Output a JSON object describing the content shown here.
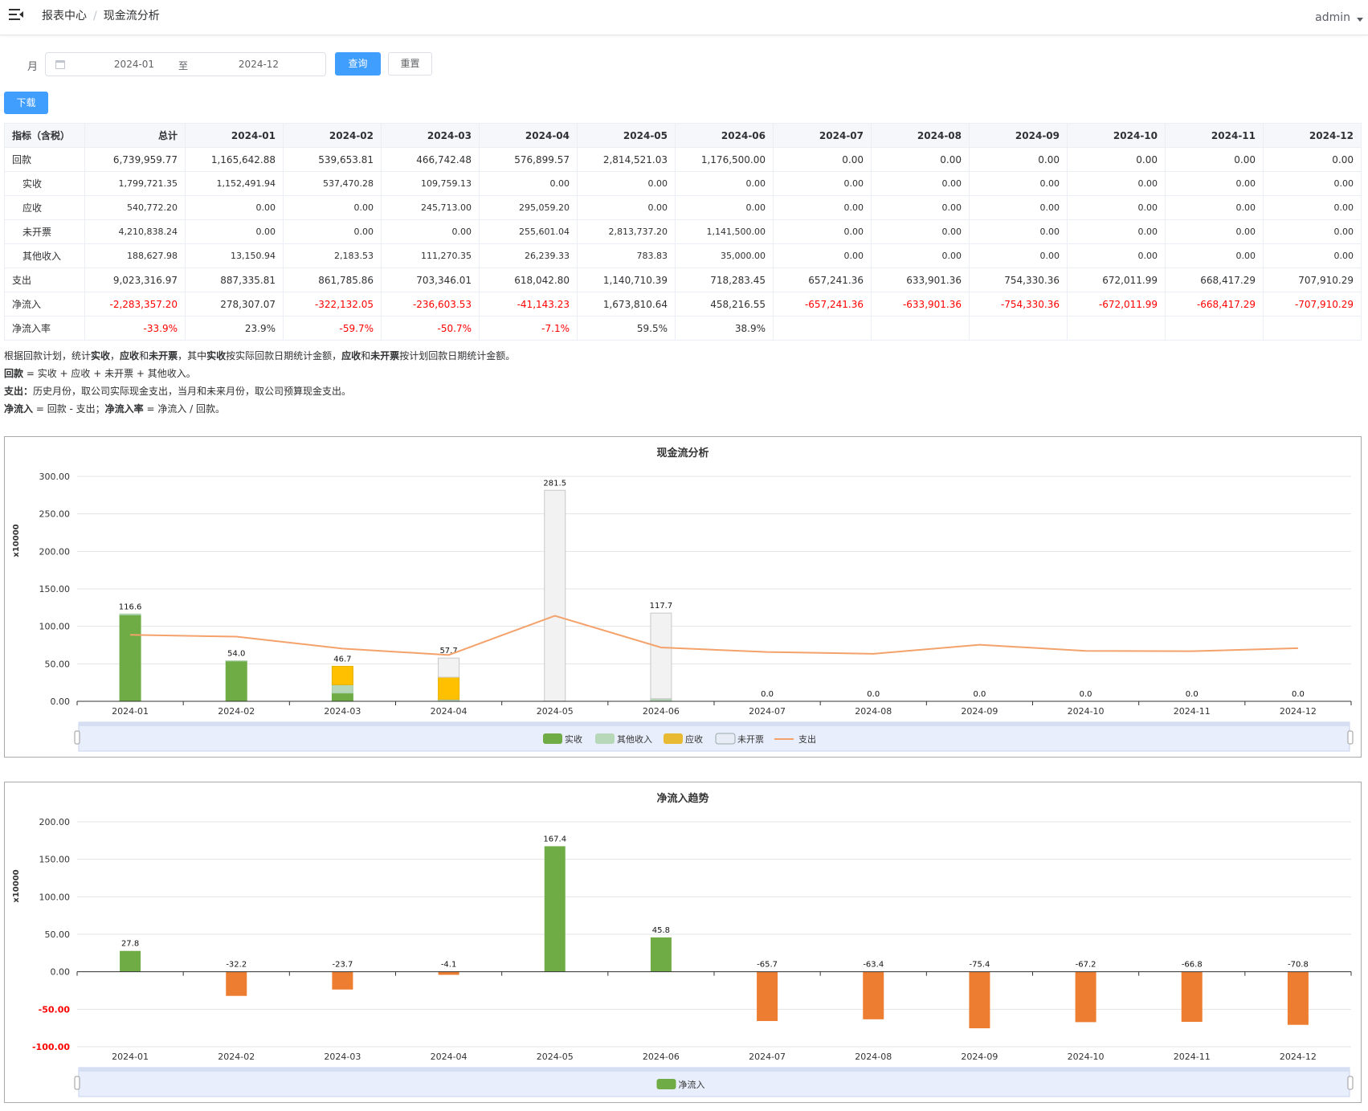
{
  "header": {
    "breadcrumb": [
      "报表中心",
      "现金流分析"
    ],
    "user": "admin"
  },
  "filter": {
    "label": "月",
    "start": "2024-01",
    "separator": "至",
    "end": "2024-12",
    "query_label": "查询",
    "reset_label": "重置"
  },
  "download_label": "下载",
  "table": {
    "headers": [
      "指标（含税）",
      "总计",
      "2024-01",
      "2024-02",
      "2024-03",
      "2024-04",
      "2024-05",
      "2024-06",
      "2024-07",
      "2024-08",
      "2024-09",
      "2024-10",
      "2024-11",
      "2024-12"
    ],
    "rows": [
      {
        "label": "回款",
        "sub": false,
        "cells": [
          "6,739,959.77",
          "1,165,642.88",
          "539,653.81",
          "466,742.48",
          "576,899.57",
          "2,814,521.03",
          "1,176,500.00",
          "0.00",
          "0.00",
          "0.00",
          "0.00",
          "0.00",
          "0.00"
        ]
      },
      {
        "label": "实收",
        "sub": true,
        "cells": [
          "1,799,721.35",
          "1,152,491.94",
          "537,470.28",
          "109,759.13",
          "0.00",
          "0.00",
          "0.00",
          "0.00",
          "0.00",
          "0.00",
          "0.00",
          "0.00",
          "0.00"
        ]
      },
      {
        "label": "应收",
        "sub": true,
        "cells": [
          "540,772.20",
          "0.00",
          "0.00",
          "245,713.00",
          "295,059.20",
          "0.00",
          "0.00",
          "0.00",
          "0.00",
          "0.00",
          "0.00",
          "0.00",
          "0.00"
        ]
      },
      {
        "label": "未开票",
        "sub": true,
        "cells": [
          "4,210,838.24",
          "0.00",
          "0.00",
          "0.00",
          "255,601.04",
          "2,813,737.20",
          "1,141,500.00",
          "0.00",
          "0.00",
          "0.00",
          "0.00",
          "0.00",
          "0.00"
        ]
      },
      {
        "label": "其他收入",
        "sub": true,
        "cells": [
          "188,627.98",
          "13,150.94",
          "2,183.53",
          "111,270.35",
          "26,239.33",
          "783.83",
          "35,000.00",
          "0.00",
          "0.00",
          "0.00",
          "0.00",
          "0.00",
          "0.00"
        ]
      },
      {
        "label": "支出",
        "sub": false,
        "cells": [
          "9,023,316.97",
          "887,335.81",
          "861,785.86",
          "703,346.01",
          "618,042.80",
          "1,140,710.39",
          "718,283.45",
          "657,241.36",
          "633,901.36",
          "754,330.36",
          "672,011.99",
          "668,417.29",
          "707,910.29"
        ]
      },
      {
        "label": "净流入",
        "sub": false,
        "cells": [
          "-2,283,357.20",
          "278,307.07",
          "-322,132.05",
          "-236,603.53",
          "-41,143.23",
          "1,673,810.64",
          "458,216.55",
          "-657,241.36",
          "-633,901.36",
          "-754,330.36",
          "-672,011.99",
          "-668,417.29",
          "-707,910.29"
        ]
      },
      {
        "label": "净流入率",
        "sub": false,
        "cells": [
          "-33.9%",
          "23.9%",
          "-59.7%",
          "-50.7%",
          "-7.1%",
          "59.5%",
          "38.9%",
          "",
          "",
          "",
          "",
          "",
          ""
        ]
      }
    ]
  },
  "notes": {
    "l1": [
      "根据回款计划，统计",
      "实收",
      "，",
      "应收",
      "和",
      "未开票",
      "，其中",
      "实收",
      "按实际回款日期统计金额，",
      "应收",
      "和",
      "未开票",
      "按计划回款日期统计金额。"
    ],
    "l2": [
      "回款",
      " = 实收 + 应收 + 未开票 + 其他收入。"
    ],
    "l3": [
      "支出：",
      "历史月份，取公司实际现金支出，当月和未来月份，取公司预算现金支出。"
    ],
    "l4": [
      "净流入",
      " = 回款 - 支出；",
      "净流入率",
      " = 净流入 / 回款。"
    ]
  },
  "colors": {
    "shishou": "#6fac46",
    "other": "#b7d7b9",
    "yingshou": "#ffc000",
    "weikaipiao": "#f2f2f2",
    "zhichu": "#f4a26c",
    "netpos": "#6fac46",
    "netneg": "#ed7d31",
    "red": "#ff0000"
  },
  "chart_data": [
    {
      "type": "bar",
      "title": "现金流分析",
      "ylabel": "x10000",
      "ylim": [
        0,
        300
      ],
      "yticks": [
        "300.00",
        "250.00",
        "200.00",
        "150.00",
        "100.00",
        "50.00",
        "0.00"
      ],
      "categories": [
        "2024-01",
        "2024-02",
        "2024-03",
        "2024-04",
        "2024-05",
        "2024-06",
        "2024-07",
        "2024-08",
        "2024-09",
        "2024-10",
        "2024-11",
        "2024-12"
      ],
      "stacked": true,
      "series": [
        {
          "name": "实收",
          "type": "bar",
          "values": [
            115.2,
            53.7,
            11.0,
            0,
            0,
            0,
            0,
            0,
            0,
            0,
            0,
            0
          ]
        },
        {
          "name": "其他收入",
          "type": "bar",
          "values": [
            1.3,
            0.2,
            11.1,
            2.6,
            0.1,
            3.5,
            0,
            0,
            0,
            0,
            0,
            0
          ]
        },
        {
          "name": "应收",
          "type": "bar",
          "values": [
            0,
            0,
            24.6,
            29.5,
            0,
            0,
            0,
            0,
            0,
            0,
            0,
            0
          ]
        },
        {
          "name": "未开票",
          "type": "bar",
          "values": [
            0,
            0,
            0,
            25.6,
            281.4,
            114.2,
            0,
            0,
            0,
            0,
            0,
            0
          ]
        },
        {
          "name": "支出",
          "type": "line",
          "values": [
            88.7,
            86.2,
            70.3,
            61.8,
            114.1,
            71.8,
            65.7,
            63.4,
            75.4,
            67.2,
            66.8,
            70.8
          ]
        }
      ],
      "totals": [
        "116.6",
        "54.0",
        "46.7",
        "57.7",
        "281.5",
        "117.7",
        "0.0",
        "0.0",
        "0.0",
        "0.0",
        "0.0",
        "0.0"
      ],
      "legend": [
        "实收",
        "其他收入",
        "应收",
        "未开票",
        "支出"
      ],
      "legend_position": "bottom"
    },
    {
      "type": "bar",
      "title": "净流入趋势",
      "ylabel": "x10000",
      "ylim": [
        -100,
        200
      ],
      "yticks": [
        "200.00",
        "150.00",
        "100.00",
        "50.00",
        "0.00",
        "-50.00",
        "-100.00"
      ],
      "categories": [
        "2024-01",
        "2024-02",
        "2024-03",
        "2024-04",
        "2024-05",
        "2024-06",
        "2024-07",
        "2024-08",
        "2024-09",
        "2024-10",
        "2024-11",
        "2024-12"
      ],
      "series": [
        {
          "name": "净流入",
          "values": [
            27.8,
            -32.2,
            -23.7,
            -4.1,
            167.4,
            45.8,
            -65.7,
            -63.4,
            -75.4,
            -67.2,
            -66.8,
            -70.8
          ]
        }
      ],
      "labels": [
        "27.8",
        "-32.2",
        "-23.7",
        "-4.1",
        "167.4",
        "45.8",
        "-65.7",
        "-63.4",
        "-75.4",
        "-67.2",
        "-66.8",
        "-70.8"
      ],
      "legend": [
        "净流入"
      ],
      "legend_position": "bottom"
    }
  ]
}
